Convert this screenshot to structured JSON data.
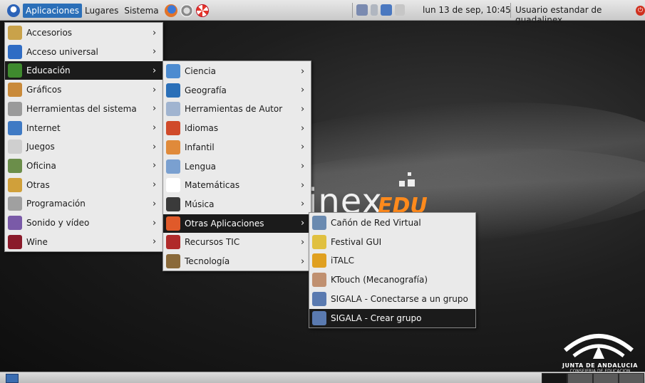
{
  "top_panel": {
    "menus": [
      "Aplicaciones",
      "Lugares",
      "Sistema"
    ],
    "launchers": [
      "firefox-icon",
      "network-icon",
      "help-icon"
    ],
    "clock": "lun 13 de sep, 10:45",
    "user": "Usuario estandar de guadalinex"
  },
  "main_menu": {
    "items": [
      {
        "label": "Accesorios",
        "icon": "accessories-icon",
        "color": "#c9a24a"
      },
      {
        "label": "Acceso universal",
        "icon": "accessibility-icon",
        "color": "#2f6cc4"
      },
      {
        "label": "Educación",
        "icon": "education-icon",
        "color": "#3f8a2e"
      },
      {
        "label": "Gráficos",
        "icon": "graphics-icon",
        "color": "#c98a3a"
      },
      {
        "label": "Herramientas del sistema",
        "icon": "system-tools-icon",
        "color": "#9a9a9a"
      },
      {
        "label": "Internet",
        "icon": "internet-icon",
        "color": "#3f7ac4"
      },
      {
        "label": "Juegos",
        "icon": "games-icon",
        "color": "#cfcfcf"
      },
      {
        "label": "Oficina",
        "icon": "office-icon",
        "color": "#6b8e4a"
      },
      {
        "label": "Otras",
        "icon": "other-icon",
        "color": "#d0a03a"
      },
      {
        "label": "Programación",
        "icon": "programming-icon",
        "color": "#a0a0a0"
      },
      {
        "label": "Sonido y vídeo",
        "icon": "sound-video-icon",
        "color": "#7a5aa8"
      },
      {
        "label": "Wine",
        "icon": "wine-icon",
        "color": "#8a1a2a"
      }
    ],
    "active_index": 2
  },
  "education_menu": {
    "items": [
      {
        "label": "Ciencia",
        "icon": "science-icon",
        "color": "#4c8bd0"
      },
      {
        "label": "Geografía",
        "icon": "geography-icon",
        "color": "#2a6fb8"
      },
      {
        "label": "Herramientas de Autor",
        "icon": "author-tools-icon",
        "color": "#a0b4d0"
      },
      {
        "label": "Idiomas",
        "icon": "languages-icon",
        "color": "#d04a2a"
      },
      {
        "label": "Infantil",
        "icon": "children-icon",
        "color": "#e08a3a"
      },
      {
        "label": "Lengua",
        "icon": "language-arts-icon",
        "color": "#7aa0d0"
      },
      {
        "label": "Matemáticas",
        "icon": "math-icon",
        "color": "#ffffff"
      },
      {
        "label": "Música",
        "icon": "music-icon",
        "color": "#3a3a3a"
      },
      {
        "label": "Otras Aplicaciones",
        "icon": "other-apps-icon",
        "color": "#e05a2a"
      },
      {
        "label": "Recursos TIC",
        "icon": "ict-resources-icon",
        "color": "#b02a2a"
      },
      {
        "label": "Tecnología",
        "icon": "technology-icon",
        "color": "#8a6a3a"
      }
    ],
    "active_index": 8
  },
  "other_apps_menu": {
    "items": [
      {
        "label": "Cañón de Red Virtual",
        "icon": "virtual-projector-icon",
        "color": "#6a8ab0"
      },
      {
        "label": "Festival GUI",
        "icon": "festival-icon",
        "color": "#e0c040"
      },
      {
        "label": "iTALC",
        "icon": "italc-icon",
        "color": "#e0a020"
      },
      {
        "label": "KTouch (Mecanografía)",
        "icon": "ktouch-icon",
        "color": "#c09070"
      },
      {
        "label": "SIGALA - Conectarse a un grupo",
        "icon": "sigala-connect-icon",
        "color": "#5a7ab0"
      },
      {
        "label": "SIGALA - Crear grupo",
        "icon": "sigala-create-icon",
        "color": "#5a7ab0"
      }
    ],
    "active_index": 5
  },
  "branding": {
    "junta_title": "JUNTA DE ANDALUCIA",
    "junta_sub": "CONSEJERIA DE EDUCACION"
  }
}
